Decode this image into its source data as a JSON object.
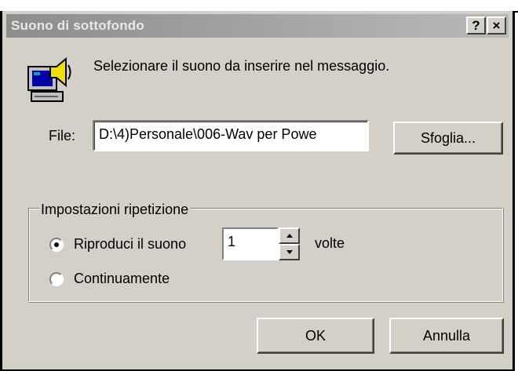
{
  "window": {
    "title": "Suono di sottofondo",
    "help_label": "?",
    "close_label": "×"
  },
  "message": {
    "text": "Selezionare il suono da inserire nel messaggio.",
    "icon": "speaker-computer-icon"
  },
  "file": {
    "label": "File:",
    "value": "D:\\4)Personale\\006-Wav per Powe",
    "browse_label": "Sfoglia..."
  },
  "repeat_group": {
    "legend": "Impostazioni ripetizione",
    "option_play": "Riproduci il suono",
    "option_play_selected": true,
    "count": "1",
    "times_label": "volte",
    "option_continuous": "Continuamente"
  },
  "footer": {
    "ok_label": "OK",
    "cancel_label": "Annulla"
  },
  "colors": {
    "dialog_bg": "#d4d0c8",
    "titlebar": "#8d8d8d"
  }
}
